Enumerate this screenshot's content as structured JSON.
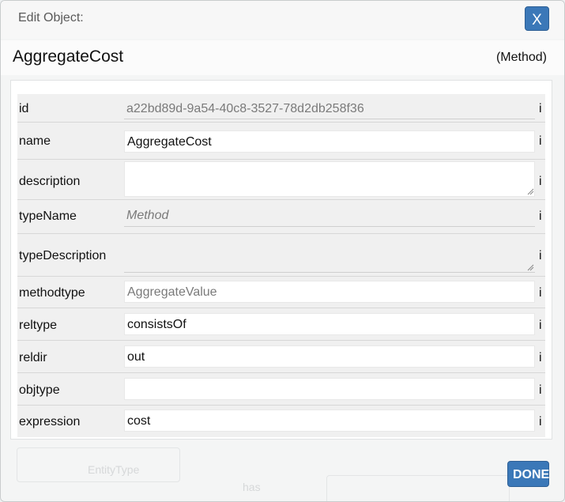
{
  "dialog": {
    "title": "Edit Object:",
    "close_label": "X",
    "object_name": "AggregateCost",
    "object_kind": "(Method)",
    "done_label": "DONE"
  },
  "fields": [
    {
      "label": "id",
      "value": "a22bd89d-9a54-40c8-3527-78d2db258f36",
      "readonly": true,
      "info": "i"
    },
    {
      "label": "name",
      "value": "AggregateCost",
      "readonly": false,
      "info": "i"
    },
    {
      "label": "description",
      "value": "",
      "readonly": false,
      "info": "i"
    },
    {
      "label": "typeName",
      "value": "Method",
      "readonly": true,
      "info": "i"
    },
    {
      "label": "typeDescription",
      "value": "",
      "readonly": true,
      "info": "i"
    },
    {
      "label": "methodtype",
      "value": "AggregateValue",
      "readonly": false,
      "info": "i"
    },
    {
      "label": "reltype",
      "value": "consistsOf",
      "readonly": false,
      "info": "i"
    },
    {
      "label": "reldir",
      "value": "out",
      "readonly": false,
      "info": "i"
    },
    {
      "label": "objtype",
      "value": "",
      "readonly": false,
      "info": "i"
    },
    {
      "label": "expression",
      "value": "cost",
      "readonly": false,
      "info": "i"
    }
  ],
  "background": {
    "node_label": "EntityType",
    "link_label": "has"
  },
  "colors": {
    "accent": "#3b78b8"
  }
}
